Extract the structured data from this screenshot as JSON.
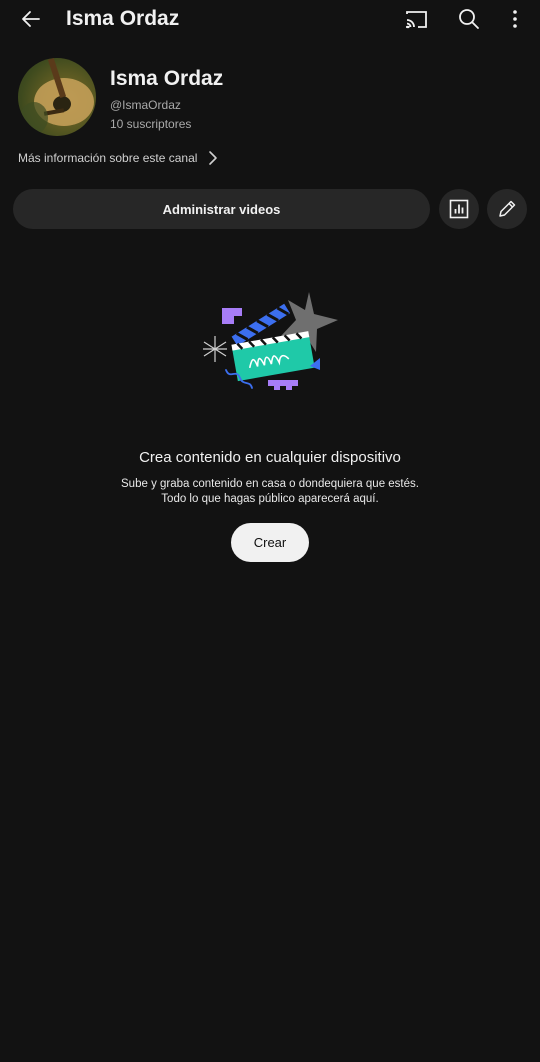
{
  "topbar": {
    "title": "Isma Ordaz",
    "icons": [
      "back-arrow-icon",
      "cast-icon",
      "search-icon",
      "more-vert-icon"
    ]
  },
  "channel": {
    "name": "Isma Ordaz",
    "handle": "@IsmaOrdaz",
    "subscribers": "10 suscriptores",
    "more_info": "Más información sobre este canal"
  },
  "actions": {
    "manage_videos": "Administrar videos",
    "icons": [
      "analytics-icon",
      "edit-pencil-icon"
    ]
  },
  "empty_state": {
    "title": "Crea contenido en cualquier dispositivo",
    "line1": "Sube y graba contenido en casa o dondequiera que estés.",
    "line2": "Todo lo que hagas público aparecerá aquí.",
    "create_label": "Crear"
  },
  "colors": {
    "background": "#121212",
    "button_bg": "#272727",
    "accent_teal": "#1fc9a8",
    "accent_blue": "#3c6ff0",
    "accent_purple": "#a77df7"
  }
}
